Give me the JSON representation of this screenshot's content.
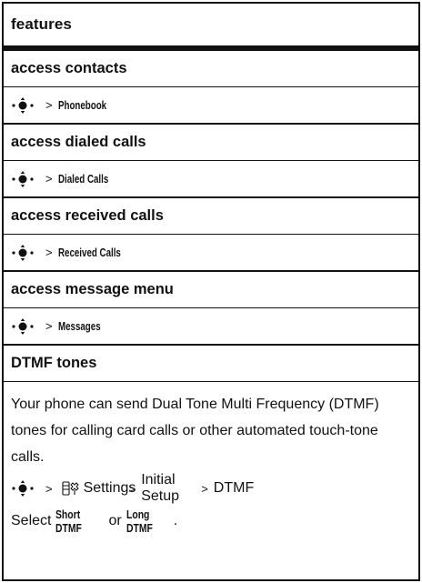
{
  "header": {
    "title": "features"
  },
  "rows": [
    {
      "title": "access contacts",
      "path": "Phonebook"
    },
    {
      "title": "access dialed calls",
      "path": "Dialed Calls"
    },
    {
      "title": "access received calls",
      "path": "Received Calls"
    },
    {
      "title": "access message menu",
      "path": "Messages"
    }
  ],
  "dtmf": {
    "title": "DTMF tones",
    "description": "Your phone can send Dual Tone Multi Frequency (DTMF) tones for calling card calls or other automated touch-tone calls.",
    "path_settings": "Settings",
    "path_initial_setup": "Initial Setup",
    "path_dtmf": "DTMF",
    "select_prefix": "Select",
    "option_short": "Short DTMF",
    "or_word": "or",
    "option_long": "Long DTMF",
    "period": "."
  },
  "symbols": {
    "gt": ">"
  },
  "icons": {
    "nav": "navigation-key-icon",
    "settings": "settings-icon"
  }
}
